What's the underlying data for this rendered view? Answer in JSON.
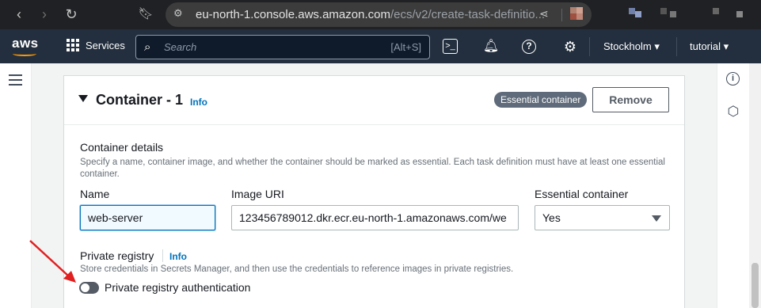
{
  "browser": {
    "url_host": "eu-north-1.console.aws.amazon.com",
    "url_path": "/ecs/v2/create-task-definitio..."
  },
  "aws_nav": {
    "logo": "aws",
    "services_label": "Services",
    "search_placeholder": "Search",
    "search_shortcut": "[Alt+S]",
    "region": "Stockholm",
    "account": "tutorial"
  },
  "container": {
    "title": "Container - 1",
    "info_label": "Info",
    "badge": "Essential container",
    "remove_label": "Remove",
    "details_title": "Container details",
    "details_desc": "Specify a name, container image, and whether the container should be marked as essential. Each task definition must have at least one essential container.",
    "name_label": "Name",
    "name_value": "web-server",
    "image_label": "Image URI",
    "image_value": "123456789012.dkr.ecr.eu-north-1.amazonaws.com/we",
    "essential_label": "Essential container",
    "essential_value": "Yes",
    "private_registry_title": "Private registry",
    "private_registry_info": "Info",
    "private_registry_desc": "Store credentials in Secrets Manager, and then use the credentials to reference images in private registries.",
    "private_registry_toggle": "Private registry authentication"
  },
  "colors": {
    "aws_nav_bg": "#232f3e",
    "accent": "#0073bb",
    "badge_bg": "#5f6b7a",
    "annotation_arrow": "#e02020"
  },
  "icons": [
    "back-icon",
    "forward-icon",
    "reload-icon",
    "bookmark-icon",
    "site-settings-icon",
    "share-icon",
    "grid-icon",
    "search-icon",
    "cloudshell-icon",
    "notifications-icon",
    "help-icon",
    "settings-icon",
    "menu-icon",
    "info-circle-icon",
    "ai-assistant-icon"
  ]
}
